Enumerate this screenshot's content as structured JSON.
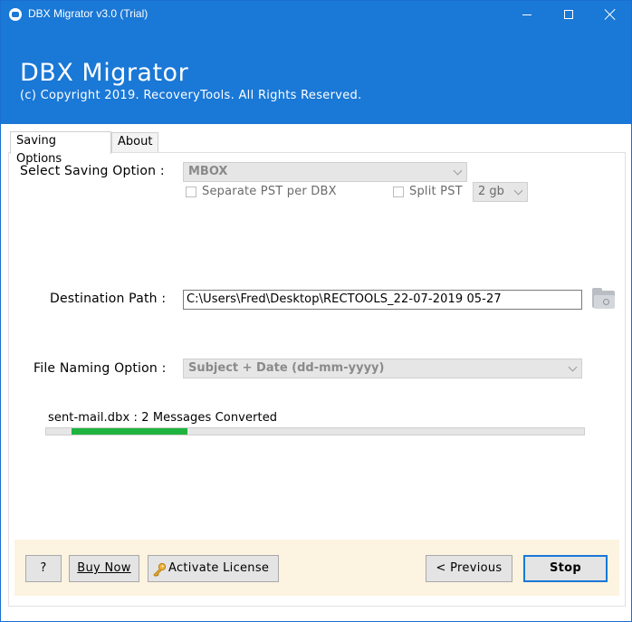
{
  "window": {
    "title": "DBX Migrator v3.0 (Trial)"
  },
  "banner": {
    "app_name": "DBX Migrator",
    "copyright": "(c) Copyright 2019. RecoveryTools. All Rights Reserved."
  },
  "tabs": [
    {
      "label": "Saving Options",
      "active": true
    },
    {
      "label": "About",
      "active": false
    }
  ],
  "saving": {
    "label": "Select Saving Option :",
    "selected": "MBOX",
    "separate_pst_label": "Separate PST per DBX",
    "separate_pst_checked": false,
    "split_pst_label": "Split PST",
    "split_pst_checked": false,
    "split_size": "2 gb"
  },
  "destination": {
    "label": "Destination Path :",
    "value": "C:\\Users\\Fred\\Desktop\\RECTOOLS_22-07-2019 05-27"
  },
  "naming": {
    "label": "File Naming Option :",
    "selected": "Subject + Date (dd-mm-yyyy)"
  },
  "progress": {
    "status_text": "sent-mail.dbx : 2 Messages Converted",
    "fraction": 0.215
  },
  "buttons": {
    "help": "?",
    "buy_now": "Buy Now",
    "activate_license": "Activate License",
    "previous": "< Previous",
    "stop": "Stop"
  },
  "colors": {
    "accent": "#1a78d6",
    "progress": "#1fb43f",
    "footer": "#fcf3e0"
  }
}
